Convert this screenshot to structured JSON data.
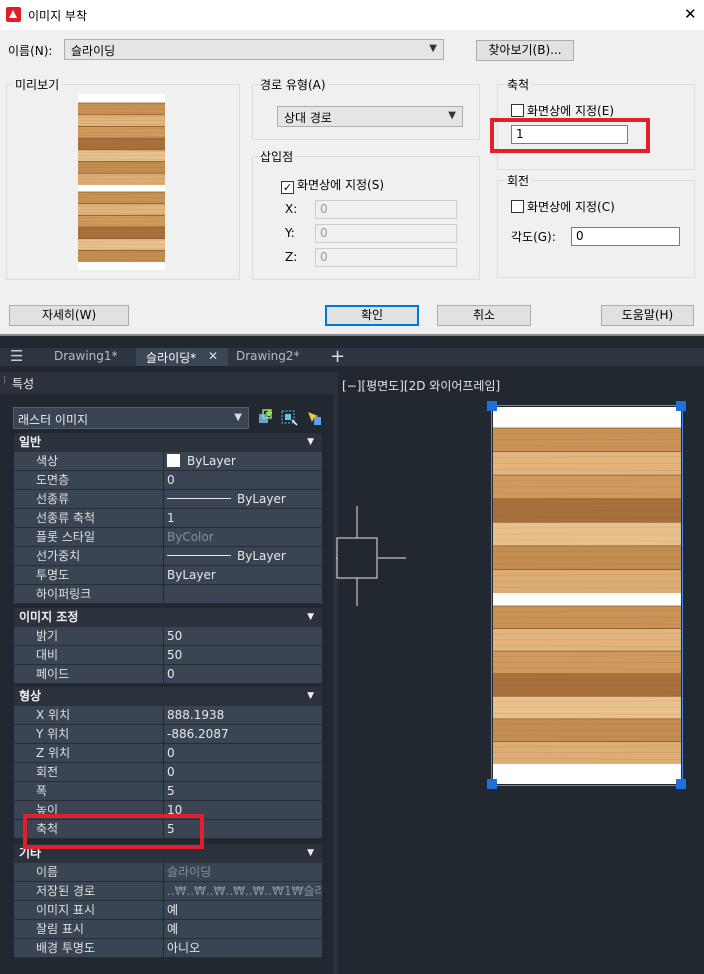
{
  "dialog": {
    "title": "이미지 부착",
    "close_glyph": "✕",
    "name_label": "이름(N):",
    "name_value": "슬라이딩",
    "browse_label": "찾아보기(B)...",
    "preview_legend": "미리보기",
    "path_legend": "경로 유형(A)",
    "path_value": "상대 경로",
    "insert_legend": "삽입점",
    "insert_onscreen": "화면상에 지정(S)",
    "x_label": "X:",
    "y_label": "Y:",
    "z_label": "Z:",
    "x_value": "0",
    "y_value": "0",
    "z_value": "0",
    "scale_legend": "축척",
    "scale_onscreen": "화면상에 지정(E)",
    "scale_value": "1",
    "rotation_legend": "회전",
    "rotation_onscreen": "화면상에 지정(C)",
    "angle_label": "각도(G):",
    "angle_value": "0",
    "details_btn": "자세히(W)",
    "ok_btn": "확인",
    "cancel_btn": "취소",
    "help_btn": "도움말(H)"
  },
  "cad": {
    "tabs": [
      "Drawing1*",
      "슬라이딩*",
      "Drawing2*"
    ],
    "tab_close": "✕",
    "tab_plus": "+",
    "menu_glyph": "☰",
    "panel_title": "특성",
    "object_type": "래스터 이미지",
    "viewport_label": "[−][평면도][2D 와이어프레임]",
    "sections": [
      {
        "title": "일반",
        "rows": [
          [
            "색상",
            "ByLayer"
          ],
          [
            "도면층",
            "0"
          ],
          [
            "선종류",
            "ByLayer"
          ],
          [
            "선종류 축척",
            "1"
          ],
          [
            "플롯 스타일",
            "ByColor"
          ],
          [
            "선가중치",
            "ByLayer"
          ],
          [
            "투명도",
            "ByLayer"
          ],
          [
            "하이퍼링크",
            ""
          ]
        ]
      },
      {
        "title": "이미지 조정",
        "rows": [
          [
            "밝기",
            "50"
          ],
          [
            "대비",
            "50"
          ],
          [
            "페이드",
            "0"
          ]
        ]
      },
      {
        "title": "형상",
        "rows": [
          [
            "X 위치",
            "888.1938"
          ],
          [
            "Y 위치",
            "-886.2087"
          ],
          [
            "Z 위치",
            "0"
          ],
          [
            "회전",
            "0"
          ],
          [
            "폭",
            "5"
          ],
          [
            "높이",
            "10"
          ],
          [
            "축척",
            "5"
          ]
        ]
      },
      {
        "title": "기타",
        "rows": [
          [
            "이름",
            "슬라이딩"
          ],
          [
            "저장된 경로",
            "..₩..₩..₩..₩..₩..₩1₩슬라이..."
          ],
          [
            "이미지 표시",
            "예"
          ],
          [
            "잘림 표시",
            "예"
          ],
          [
            "배경 투명도",
            "아니오"
          ]
        ]
      }
    ]
  },
  "colors": {
    "highlight": "#e0202a",
    "selection": "#1e6fe0",
    "wood_dark": "#c08a4d",
    "wood_light": "#e6bf8a"
  }
}
